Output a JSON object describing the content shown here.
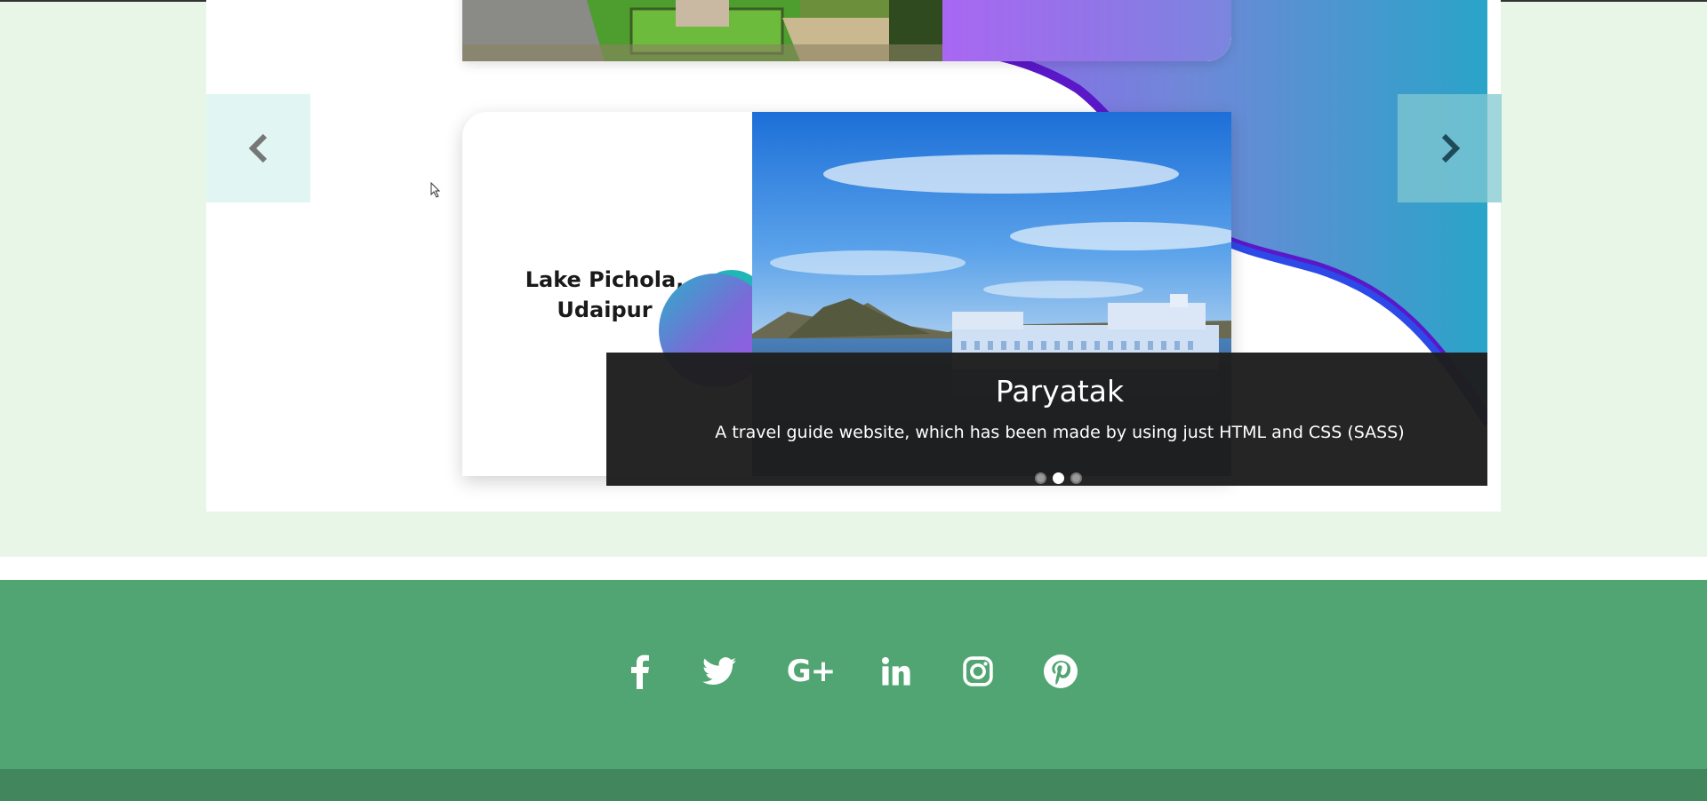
{
  "carousel": {
    "slides": [
      {
        "title": "Lake Pichola,\nUdaipur"
      }
    ],
    "current_slide": 2,
    "total_slides": 3,
    "caption": {
      "title": "Paryatak",
      "description": "A travel guide website, which has been made by using just HTML and CSS (SASS)"
    },
    "prev_icon": "chevron-left-icon",
    "next_icon": "chevron-right-icon"
  },
  "footer": {
    "social": [
      {
        "name": "facebook",
        "icon": "facebook-icon"
      },
      {
        "name": "twitter",
        "icon": "twitter-icon"
      },
      {
        "name": "google-plus",
        "icon": "google-plus-icon",
        "label": "G+"
      },
      {
        "name": "linkedin",
        "icon": "linkedin-icon"
      },
      {
        "name": "instagram",
        "icon": "instagram-icon"
      },
      {
        "name": "pinterest",
        "icon": "pinterest-icon"
      }
    ]
  },
  "colors": {
    "page_bg": "#e8f6e8",
    "footer_bg": "#51a572",
    "footer_bottom_bg": "#42865d",
    "caption_bg": "#1e1e1e"
  }
}
